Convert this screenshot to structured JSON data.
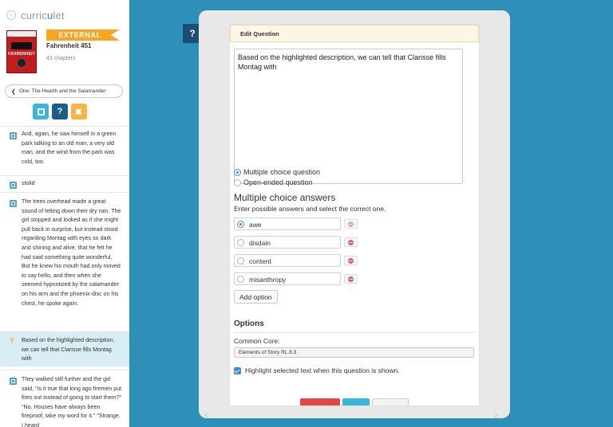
{
  "app": {
    "logo_text_a": "curric",
    "logo_text_u": "u",
    "logo_text_b": "let"
  },
  "book": {
    "badge": "EXTERNAL",
    "title": "Fahrenheit 451",
    "chapters": "43 chapters",
    "cover_title": "FAHRENHEIT"
  },
  "chapter_button": {
    "label": "One: The Hearth and the Salamander"
  },
  "toolbar": {
    "help_glyph": "?"
  },
  "sidebar_items": [
    {
      "type": "text",
      "text": "And, again, he saw himself in a green park talking to an old man, a very old man, and the wind from the park was cold, too."
    },
    {
      "type": "text",
      "text": "stolid"
    },
    {
      "type": "image",
      "text": "The trees overhead made a great sound of letting down their dry rain. The girl stopped and looked as if she might pull back in surprise, but instead stood regarding Montag with eyes so dark and shining and alive, that he felt he had said something quite wonderful. But he knew his mouth had only moved to say hello, and then when she seemed hypnotized by the salamander on his arm and the phoenix-disc on his chest, he spoke again."
    },
    {
      "type": "question",
      "glyph": "?",
      "text": "Based on the highlighted description, we can tell that Clarisse fills Montag with"
    },
    {
      "type": "image",
      "text": "They walked still further and the girl said, \"Is it true that long ago firemen put fires out instead of going to start them?\" \"No. Houses have always been fireproof, take my word for it.\" \"Strange. I heard"
    }
  ],
  "main": {
    "help_glyph": "?",
    "prev_arrow": "‹",
    "next_arrow": "›"
  },
  "dialog": {
    "title": "Edit Question",
    "question_text": "Based on the highlighted description, we can tell that Clarisse fills Montag with",
    "type_multiple": "Multiple choice question",
    "type_open": "Open-ended question",
    "selected_type": "multiple",
    "mc_title": "Multiple choice answers",
    "mc_sub": "Enter possible answers and select the correct one.",
    "options": [
      {
        "label": "awe",
        "correct": true
      },
      {
        "label": "disdain",
        "correct": false
      },
      {
        "label": "content",
        "correct": false
      },
      {
        "label": "misanthropy",
        "correct": false
      }
    ],
    "add_option": "Add option",
    "options_heading": "Options",
    "common_core_label": "Common Core:",
    "common_core_value": "Elements of Story RL.8.3",
    "highlight_label": "Highlight selected text when this question is shown."
  }
}
